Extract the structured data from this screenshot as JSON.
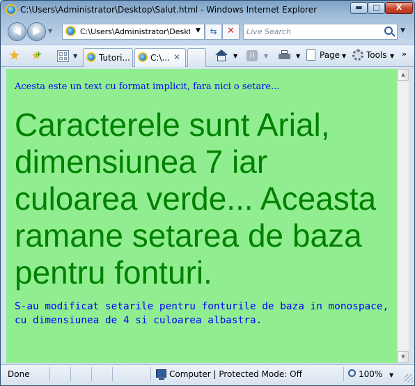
{
  "window": {
    "title": "C:\\Users\\Administrator\\Desktop\\Salut.html - Windows Internet Explorer",
    "minimize_glyph": "▬",
    "maximize_glyph": "□",
    "close_glyph": "X"
  },
  "address_bar": {
    "url": "C:\\Users\\Administrator\\Desktop\\Salut.html",
    "refresh_glyph": "⇆",
    "stop_glyph": "✕"
  },
  "search": {
    "placeholder": "Live Search"
  },
  "tabs": [
    {
      "label": "Tutori...",
      "active": false
    },
    {
      "label": "C:\\...",
      "active": true,
      "close_glyph": "✕"
    }
  ],
  "command_bar": {
    "feeds_glyph": "))",
    "page_label": "Page",
    "tools_label": "Tools",
    "more_glyph": "»"
  },
  "content": {
    "background": "#90ee90",
    "default_text": "Acesta este un text cu format implicit, fara nici o setare...",
    "arial_text": "Caracterele sunt Arial, dimensiunea 7 iar culoarea verde... Aceasta ramane setarea de baza pentru fonturi.",
    "mono_text": "S-au modificat setarile pentru fonturile de baza in monospace, cu dimensiunea de 4 si culoarea albastra."
  },
  "status_bar": {
    "status": "Done",
    "zone": "Computer | Protected Mode: Off",
    "zoom": "100%"
  },
  "icons": {
    "favorites": "star-icon",
    "add_favorites": "add-favorites-icon",
    "home": "home-icon",
    "feeds": "rss-feed-icon",
    "print": "printer-icon",
    "tools": "gear-icon",
    "zone": "computer-icon"
  },
  "colors": {
    "content_bg": "#90ee90",
    "green_text": "#008000",
    "blue_text": "#0000ff"
  }
}
